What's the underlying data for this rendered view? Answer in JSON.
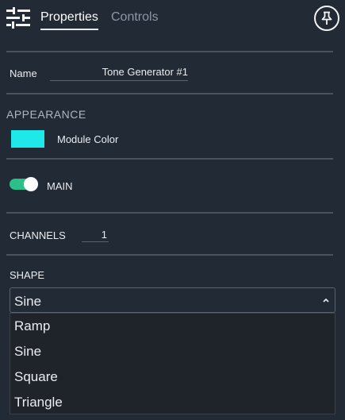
{
  "header": {
    "tabs": [
      {
        "label": "Properties",
        "active": true
      },
      {
        "label": "Controls",
        "active": false
      }
    ],
    "icons": {
      "left": "sliders-icon",
      "right": "pin-icon"
    }
  },
  "name": {
    "label": "Name",
    "value": "Tone Generator #1"
  },
  "appearance": {
    "section_title": "APPEARANCE",
    "color_label": "Module Color",
    "color": "#1ee8ea"
  },
  "main": {
    "label": "MAIN",
    "enabled": true,
    "toggle_color": "#2bbf8a"
  },
  "channels": {
    "label": "CHANNELS",
    "value": "1"
  },
  "shape": {
    "section_title": "SHAPE",
    "selected": "Sine",
    "options": [
      "Ramp",
      "Sine",
      "Square",
      "Triangle"
    ]
  }
}
